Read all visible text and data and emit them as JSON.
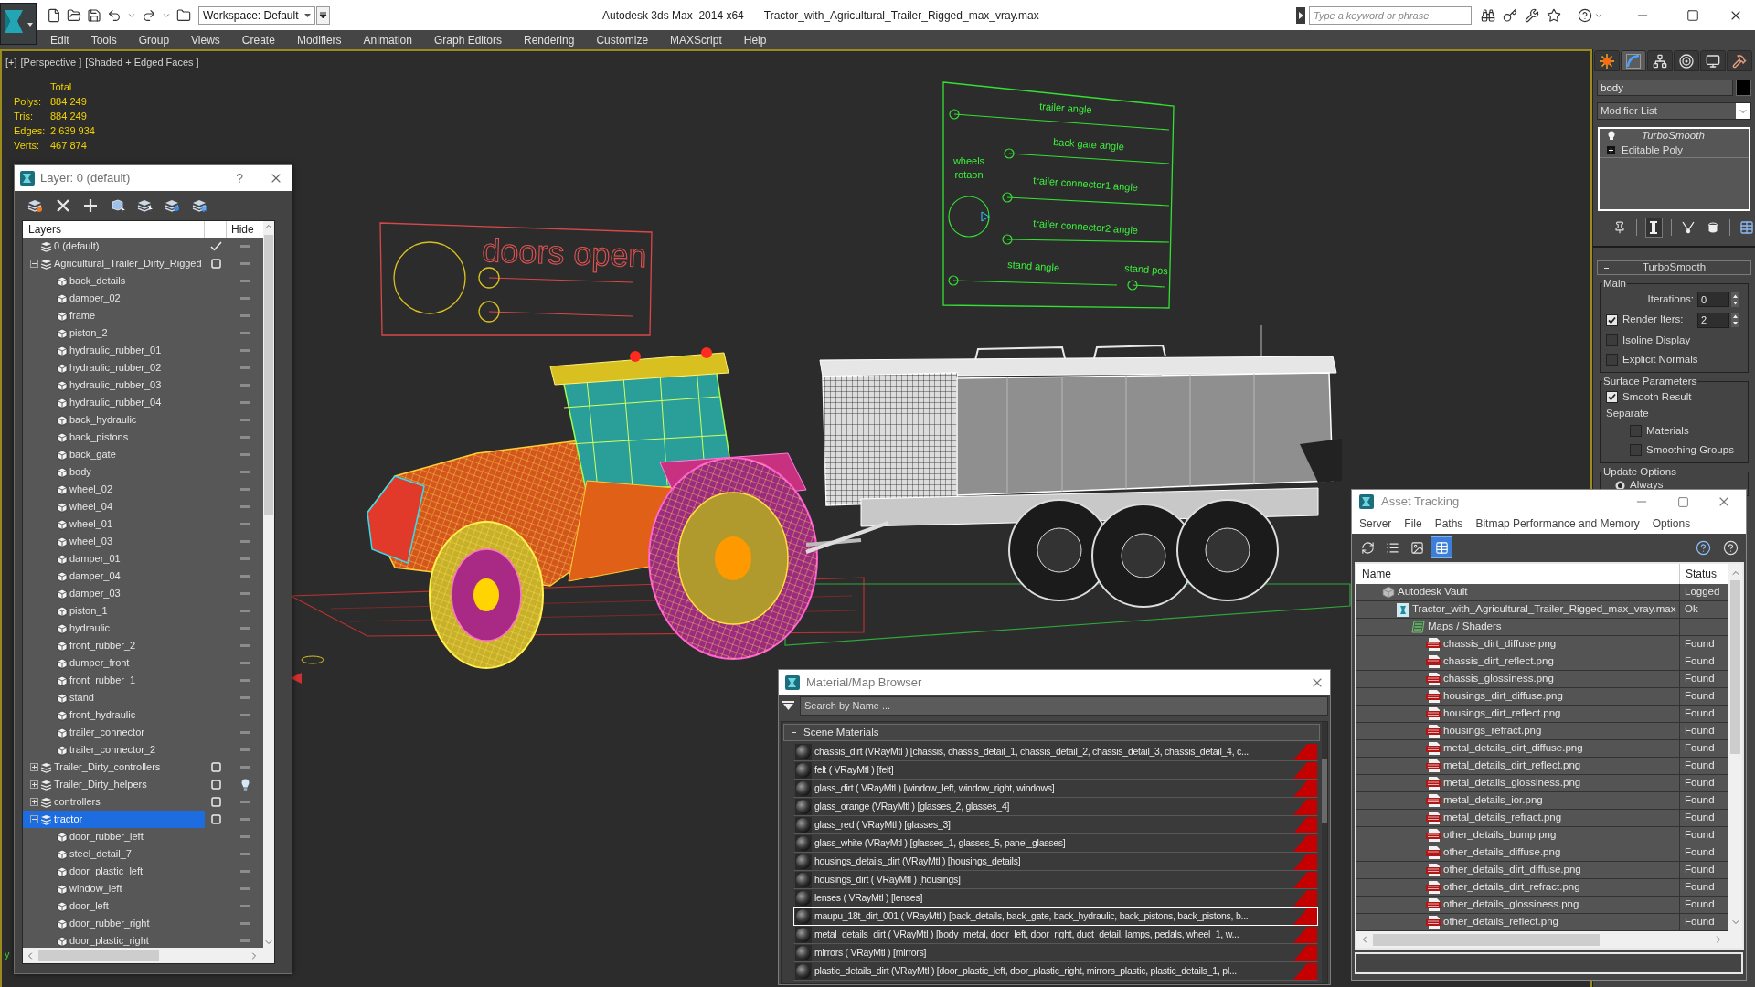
{
  "title_bar": {
    "workspace": "Workspace: Default",
    "app_title": "Autodesk 3ds Max  2014 x64",
    "file_name": "Tractor_with_Agricultural_Trailer_Rigged_max_vray.max",
    "search": {
      "placeholder": "Type a keyword or phrase"
    }
  },
  "menu_bar": [
    "Edit",
    "Tools",
    "Group",
    "Views",
    "Create",
    "Modifiers",
    "Animation",
    "Graph Editors",
    "Rendering",
    "Customize",
    "MAXScript",
    "Help"
  ],
  "viewport": {
    "labels": [
      "[+]",
      "[Perspective ]",
      "[Shaded + Edged Faces ]"
    ],
    "stats": {
      "header": "Total",
      "rows": [
        {
          "label": "Polys:",
          "value": "884 249"
        },
        {
          "label": "Tris:",
          "value": "884 249"
        },
        {
          "label": "Edges:",
          "value": "2 639 934"
        },
        {
          "label": "Verts:",
          "value": "467 874"
        }
      ]
    },
    "doors_panel": {
      "title": "doors open",
      "sliders": [
        {
          "level": 0
        },
        {
          "level": 0
        }
      ]
    },
    "controls_panel": {
      "dial_label": [
        "wheels",
        "rotaon"
      ],
      "sliders": [
        {
          "label": "trailer angle",
          "level": 0
        },
        {
          "label": "back gate angle",
          "level": 0
        },
        {
          "label": "trailer connector1 angle",
          "level": 0
        },
        {
          "label": "trailer connector2 angle",
          "level": 0
        },
        {
          "label": "stand angle",
          "level": 0
        },
        {
          "label": "stand pos",
          "level": 0
        }
      ]
    },
    "axis_label": "y"
  },
  "layer_dialog": {
    "title": "Layer: 0 (default)",
    "help": "?",
    "columns": [
      "Layers",
      "Hide"
    ],
    "layers": [
      {
        "name": "0 (default)",
        "kind": "layer",
        "current": true,
        "selected": false,
        "hidden": false
      },
      {
        "name": "Agricultural_Trailer_Dirty_Rigged",
        "kind": "layer",
        "current": false,
        "selected": false,
        "hidden": false,
        "expanded": true,
        "children": [
          {
            "name": "back_details",
            "kind": "object",
            "selected": false,
            "hidden": false
          },
          {
            "name": "damper_02",
            "kind": "object",
            "selected": false,
            "hidden": false
          },
          {
            "name": "frame",
            "kind": "object",
            "selected": false,
            "hidden": false
          },
          {
            "name": "piston_2",
            "kind": "object",
            "selected": false,
            "hidden": false
          },
          {
            "name": "hydraulic_rubber_01",
            "kind": "object",
            "selected": false,
            "hidden": false
          },
          {
            "name": "hydraulic_rubber_02",
            "kind": "object",
            "selected": false,
            "hidden": false
          },
          {
            "name": "hydraulic_rubber_03",
            "kind": "object",
            "selected": false,
            "hidden": false
          },
          {
            "name": "hydraulic_rubber_04",
            "kind": "object",
            "selected": false,
            "hidden": false
          },
          {
            "name": "back_hydraulic",
            "kind": "object",
            "selected": false,
            "hidden": false
          },
          {
            "name": "back_pistons",
            "kind": "object",
            "selected": false,
            "hidden": false
          },
          {
            "name": "back_gate",
            "kind": "object",
            "selected": false,
            "hidden": false
          },
          {
            "name": "body",
            "kind": "object",
            "selected": false,
            "hidden": false
          },
          {
            "name": "wheel_02",
            "kind": "object",
            "selected": false,
            "hidden": false
          },
          {
            "name": "wheel_04",
            "kind": "object",
            "selected": false,
            "hidden": false
          },
          {
            "name": "wheel_01",
            "kind": "object",
            "selected": false,
            "hidden": false
          },
          {
            "name": "wheel_03",
            "kind": "object",
            "selected": false,
            "hidden": false
          },
          {
            "name": "damper_01",
            "kind": "object",
            "selected": false,
            "hidden": false
          },
          {
            "name": "damper_04",
            "kind": "object",
            "selected": false,
            "hidden": false
          },
          {
            "name": "damper_03",
            "kind": "object",
            "selected": false,
            "hidden": false
          },
          {
            "name": "piston_1",
            "kind": "object",
            "selected": false,
            "hidden": false
          },
          {
            "name": "hydraulic",
            "kind": "object",
            "selected": false,
            "hidden": false
          },
          {
            "name": "front_rubber_2",
            "kind": "object",
            "selected": false,
            "hidden": false
          },
          {
            "name": "dumper_front",
            "kind": "object",
            "selected": false,
            "hidden": false
          },
          {
            "name": "front_rubber_1",
            "kind": "object",
            "selected": false,
            "hidden": false
          },
          {
            "name": "stand",
            "kind": "object",
            "selected": false,
            "hidden": false
          },
          {
            "name": "front_hydraulic",
            "kind": "object",
            "selected": false,
            "hidden": false
          },
          {
            "name": "trailer_connector",
            "kind": "object",
            "selected": false,
            "hidden": false
          },
          {
            "name": "trailer_connector_2",
            "kind": "object",
            "selected": false,
            "hidden": false
          }
        ]
      },
      {
        "name": "Trailer_Dirty_controllers",
        "kind": "layer",
        "current": false,
        "selected": false,
        "hidden": false,
        "expanded": false
      },
      {
        "name": "Trailer_Dirty_helpers",
        "kind": "layer",
        "current": false,
        "selected": false,
        "hidden": true,
        "expanded": false
      },
      {
        "name": "controllers",
        "kind": "layer",
        "current": false,
        "selected": false,
        "hidden": false,
        "expanded": false
      },
      {
        "name": "tractor",
        "kind": "layer",
        "current": false,
        "selected": true,
        "hidden": false,
        "expanded": true,
        "children": [
          {
            "name": "door_rubber_left",
            "kind": "object",
            "selected": false,
            "hidden": false
          },
          {
            "name": "steel_detail_7",
            "kind": "object",
            "selected": false,
            "hidden": false
          },
          {
            "name": "door_plastic_left",
            "kind": "object",
            "selected": false,
            "hidden": false
          },
          {
            "name": "window_left",
            "kind": "object",
            "selected": false,
            "hidden": false
          },
          {
            "name": "door_left",
            "kind": "object",
            "selected": false,
            "hidden": false
          },
          {
            "name": "door_rubber_right",
            "kind": "object",
            "selected": false,
            "hidden": false
          },
          {
            "name": "door_plastic_right",
            "kind": "object",
            "selected": false,
            "hidden": false
          }
        ]
      }
    ]
  },
  "material_browser": {
    "title": "Material/Map Browser",
    "search": {
      "placeholder": "Search by Name ..."
    },
    "group": {
      "label": "Scene Materials",
      "expanded": true,
      "items": [
        {
          "text": "chassis_dirt (VRayMtl ) [chassis, chassis_detail_1, chassis_detail_2, chassis_detail_3, chassis_detail_4, c...",
          "selected": false
        },
        {
          "text": "felt ( VRayMtl ) [felt]",
          "selected": false
        },
        {
          "text": "glass_dirt ( VRayMtl ) [window_left, window_right, windows]",
          "selected": false
        },
        {
          "text": "glass_orange (VRayMtl ) [glasses_2, glasses_4]",
          "selected": false
        },
        {
          "text": "glass_red ( VRayMtl ) [glasses_3]",
          "selected": false
        },
        {
          "text": "glass_white (VRayMtl ) [glasses_1, glasses_5, panel_glasses]",
          "selected": false
        },
        {
          "text": "housings_details_dirt (VRayMtl ) [housings_details]",
          "selected": false
        },
        {
          "text": "housings_dirt ( VRayMtl ) [housings]",
          "selected": false
        },
        {
          "text": "lenses ( VRayMtl ) [lenses]",
          "selected": false
        },
        {
          "text": "maupu_18t_dirt_001 ( VRayMtl ) [back_details, back_gate, back_hydraulic, back_pistons, back_pistons, b...",
          "selected": true
        },
        {
          "text": "metal_details_dirt ( VRayMtl ) [body_metal, door_left, door_right, duct_detail, lamps, pedals, wheel_1, w...",
          "selected": false
        },
        {
          "text": "mirrors ( VRayMtl ) [mirrors]",
          "selected": false
        },
        {
          "text": "plastic_details_dirt (VRayMtl ) [door_plastic_left, door_plastic_right, mirrors_plastic, plastic_details_1, pl...",
          "selected": false
        }
      ]
    }
  },
  "asset_tracking": {
    "title": "Asset Tracking",
    "menu": [
      "Server",
      "File",
      "Paths",
      "Bitmap Performance and Memory",
      "Options"
    ],
    "view_buttons": [
      {
        "selected": false
      },
      {
        "selected": false
      },
      {
        "selected": false
      },
      {
        "selected": true
      }
    ],
    "columns": [
      "Name",
      "Status"
    ],
    "rows": [
      {
        "name": "Autodesk Vault",
        "kind": "server",
        "status": "Logged",
        "children": [
          {
            "name": "Tractor_with_Agricultural_Trailer_Rigged_max_vray.max",
            "kind": "scene",
            "status": "Ok",
            "children": [
              {
                "name": "Maps / Shaders",
                "kind": "folder",
                "children": [
                  {
                    "name": "chassis_dirt_diffuse.png",
                    "kind": "bitmap",
                    "status": "Found"
                  },
                  {
                    "name": "chassis_dirt_reflect.png",
                    "kind": "bitmap",
                    "status": "Found"
                  },
                  {
                    "name": "chassis_glossiness.png",
                    "kind": "bitmap",
                    "status": "Found"
                  },
                  {
                    "name": "housings_dirt_diffuse.png",
                    "kind": "bitmap",
                    "status": "Found"
                  },
                  {
                    "name": "housings_dirt_reflect.png",
                    "kind": "bitmap",
                    "status": "Found"
                  },
                  {
                    "name": "housings_refract.png",
                    "kind": "bitmap",
                    "status": "Found"
                  },
                  {
                    "name": "metal_details_dirt_diffuse.png",
                    "kind": "bitmap",
                    "status": "Found"
                  },
                  {
                    "name": "metal_details_dirt_reflect.png",
                    "kind": "bitmap",
                    "status": "Found"
                  },
                  {
                    "name": "metal_details_glossiness.png",
                    "kind": "bitmap",
                    "status": "Found"
                  },
                  {
                    "name": "metal_details_ior.png",
                    "kind": "bitmap",
                    "status": "Found"
                  },
                  {
                    "name": "metal_details_refract.png",
                    "kind": "bitmap",
                    "status": "Found"
                  },
                  {
                    "name": "other_details_bump.png",
                    "kind": "bitmap",
                    "status": "Found"
                  },
                  {
                    "name": "other_details_diffuse.png",
                    "kind": "bitmap",
                    "status": "Found"
                  },
                  {
                    "name": "other_details_dirt_diffuse.png",
                    "kind": "bitmap",
                    "status": "Found"
                  },
                  {
                    "name": "other_details_dirt_refract.png",
                    "kind": "bitmap",
                    "status": "Found"
                  },
                  {
                    "name": "other_details_glossiness.png",
                    "kind": "bitmap",
                    "status": "Found"
                  },
                  {
                    "name": "other_details_reflect.png",
                    "kind": "bitmap",
                    "status": "Found"
                  }
                ]
              }
            ]
          }
        ]
      }
    ]
  },
  "command_panel": {
    "tabs": [
      {
        "selected": false
      },
      {
        "selected": true
      },
      {
        "selected": false
      },
      {
        "selected": false
      },
      {
        "selected": false
      },
      {
        "selected": false
      }
    ],
    "object_name": "body",
    "modifier_list": "Modifier List",
    "stack": [
      {
        "name": "TurboSmooth",
        "kind": "modifier"
      },
      {
        "name": "Editable Poly",
        "kind": "base"
      }
    ],
    "stack_tools": [
      {
        "pressed": false
      },
      {
        "pressed": true
      },
      {
        "pressed": false
      },
      {
        "pressed": false
      },
      {
        "pressed": false
      }
    ],
    "rollout": {
      "title": "TurboSmooth",
      "expanded": true,
      "groups": [
        {
          "label": "Main",
          "controls": [
            {
              "kind": "spinner",
              "label": "Iterations:",
              "value": "0"
            },
            {
              "kind": "check_spinner",
              "label": "Render Iters:",
              "checked": true,
              "value": "2"
            },
            {
              "kind": "checkbox",
              "label": "Isoline Display",
              "checked": false
            },
            {
              "kind": "checkbox",
              "label": "Explicit Normals",
              "checked": false
            }
          ]
        },
        {
          "label": "Surface Parameters",
          "controls": [
            {
              "kind": "checkbox",
              "label": "Smooth Result",
              "checked": true
            },
            {
              "kind": "section",
              "label": "Separate",
              "children": [
                {
                  "kind": "checkbox",
                  "label": "Materials",
                  "checked": false
                },
                {
                  "kind": "checkbox",
                  "label": "Smoothing Groups",
                  "checked": false
                }
              ]
            }
          ]
        },
        {
          "label": "Update Options",
          "controls": [
            {
              "kind": "radio",
              "label": "Always",
              "selected": true
            }
          ]
        }
      ]
    }
  }
}
